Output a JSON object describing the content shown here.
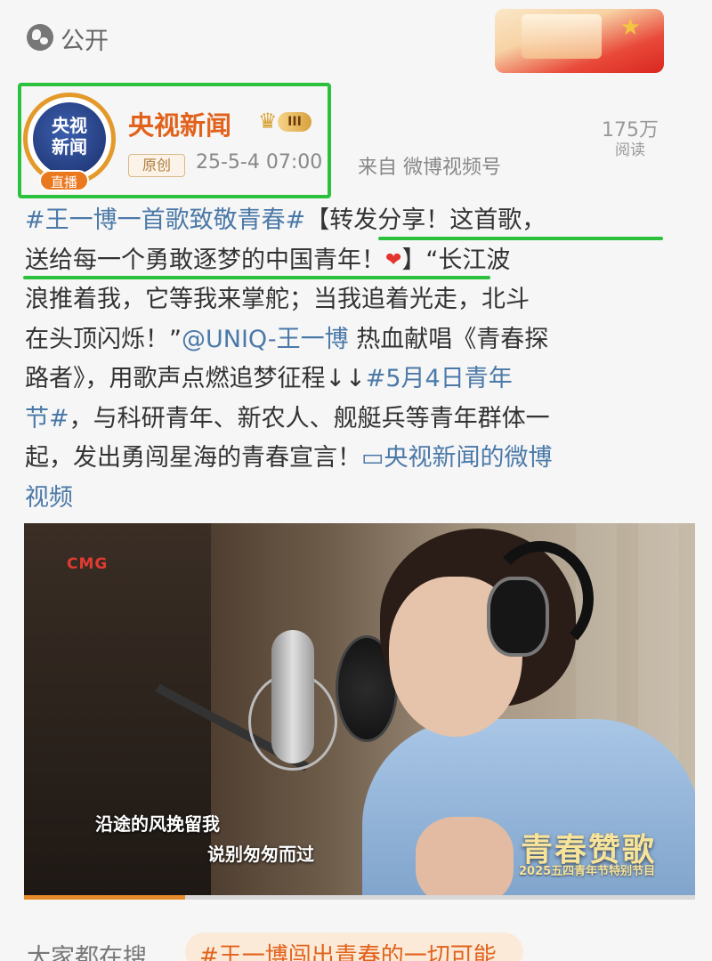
{
  "top": {
    "visibility_label": "公开"
  },
  "author": {
    "avatar_line1": "央视",
    "avatar_line2": "新闻",
    "live_badge": "直播",
    "name": "央视新闻",
    "level_badge": "III",
    "original_tag": "原创",
    "time": "25-5-4 07:00",
    "source": "来自 微博视频号",
    "read_count": "175万",
    "read_label": "阅读"
  },
  "post": {
    "line1_hash": "#王一博一首歌致敬青春#",
    "line1_text": "【转发分享！这首歌，",
    "line2_text": "送给每一个勇敢逐梦的中国青年！",
    "line2_after": "】“长江波",
    "line3_text": "浪推着我，它等我来掌舵；当我追着光走，北斗",
    "line4_text": "在头顶闪烁！”",
    "line4_mention": "@UNIQ-王一博",
    "line4_after": " 热血献唱《青春探",
    "line5_text": "路者》，用歌声点燃追梦征程↓↓",
    "line5_hash": "#5月4日青年",
    "line6_hash": "节#",
    "line6_text": "，与科研青年、新农人、舰艇兵等青年群体一",
    "line7_text": "起，发出勇闯星海的青春宣言！",
    "line7_link": "▭央视新闻的微博",
    "line8_link": "视频"
  },
  "video": {
    "cmg_logo": "CMG",
    "lyric_line1": "沿途的风挽留我",
    "lyric_line2": "说别匆匆而过",
    "program_title": "青春赞歌",
    "program_subtitle": "2025五四青年节特别节目",
    "progress_fraction": 0.24
  },
  "search": {
    "label": "大家都在搜",
    "suggestion": "#王一博闯出青春的一切可能"
  }
}
